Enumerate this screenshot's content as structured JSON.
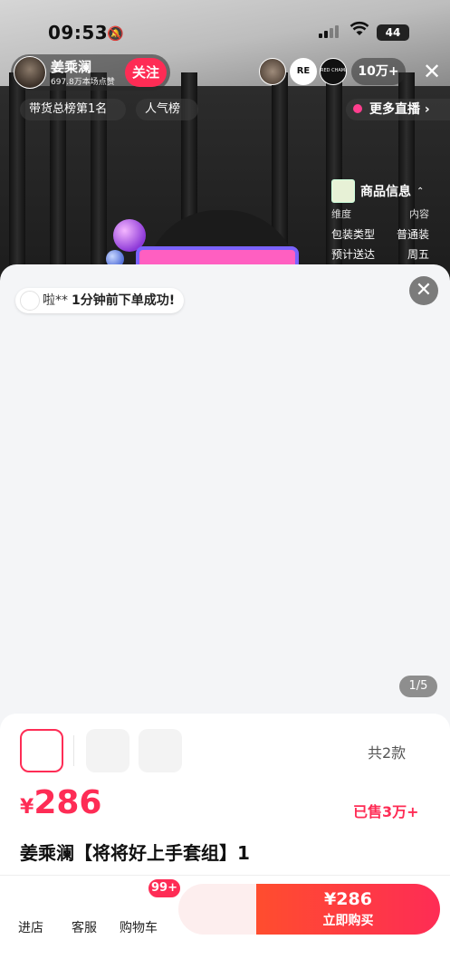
{
  "status_bar": {
    "time": "09:53",
    "battery": "44"
  },
  "host": {
    "name": "姜乘澜",
    "likes": "697.8万本场点赞",
    "follow_label": "关注"
  },
  "viewers": {
    "badge2": "RE",
    "badge3": "RED CHAMBER",
    "count": "10万+"
  },
  "pills": {
    "rank": "带货总榜第1名",
    "popularity": "人气榜",
    "more_live": "更多直播"
  },
  "product_info": {
    "title": "商品信息",
    "header": {
      "col1": "维度",
      "col2": "内容"
    },
    "rows": [
      {
        "k": "包装类型",
        "v": "普通装"
      },
      {
        "k": "预计送达",
        "v": "周五"
      }
    ]
  },
  "order_toast": {
    "name": "啦**",
    "message": "1分钟前下单成功!"
  },
  "image_counter": "1/5",
  "product": {
    "variant_count": "共2款",
    "currency": "¥",
    "price": "286",
    "sold": "已售3万+",
    "title": "姜乘澜【将将好上手套组】1"
  },
  "bottom_nav": {
    "store": "进店",
    "service": "客服",
    "cart": "购物车",
    "cart_badge": "99+",
    "buy_price": "¥286",
    "buy_label": "立即购买"
  },
  "colors": {
    "accent": "#fe2c55",
    "buy_gradient_start": "#ff4d2e"
  },
  "icons": {
    "bell": "bell-slash-icon",
    "wifi": "wifi-icon",
    "signal": "signal-icon",
    "close": "close-icon",
    "caret": "chevron-up-icon"
  }
}
